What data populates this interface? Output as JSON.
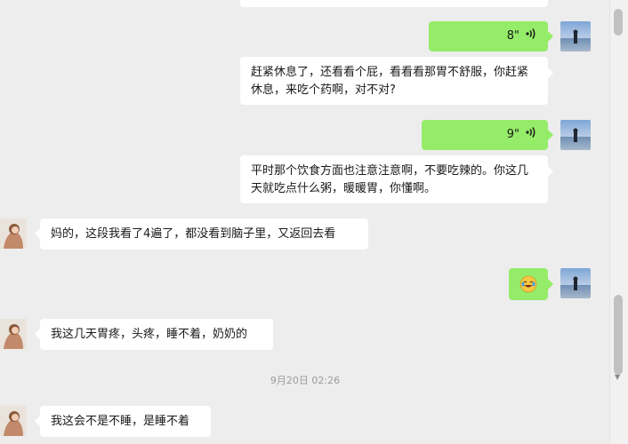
{
  "messages": {
    "voice_8": {
      "duration": "8\""
    },
    "text_rest": {
      "text": "赶紧休息了，还看看个屁，看看看那胃不舒服，你赶紧休息，来吃个药啊，对不对?"
    },
    "voice_9": {
      "duration": "9\""
    },
    "text_diet": {
      "text": "平时那个饮食方面也注意注意啊，不要吃辣的。你这几天就吃点什么粥，暖暖胃，你懂啊。"
    },
    "text_read4": {
      "text": "妈的，这段我看了4遍了，都没看到脑子里，又返回去看"
    },
    "emoji": {
      "icon": "crying-laughing-emoji"
    },
    "text_stomach": {
      "text": "我这几天胃疼，头疼，睡不着，奶奶的"
    },
    "timestamp": "9月20日 02:26",
    "text_cantsleep": {
      "text": "我这会不是不睡，是睡不着"
    }
  },
  "colors": {
    "background": "#ededed",
    "sent_voice": "#95ec69",
    "bubble_white": "#ffffff",
    "timestamp_text": "#9b9b9b"
  }
}
